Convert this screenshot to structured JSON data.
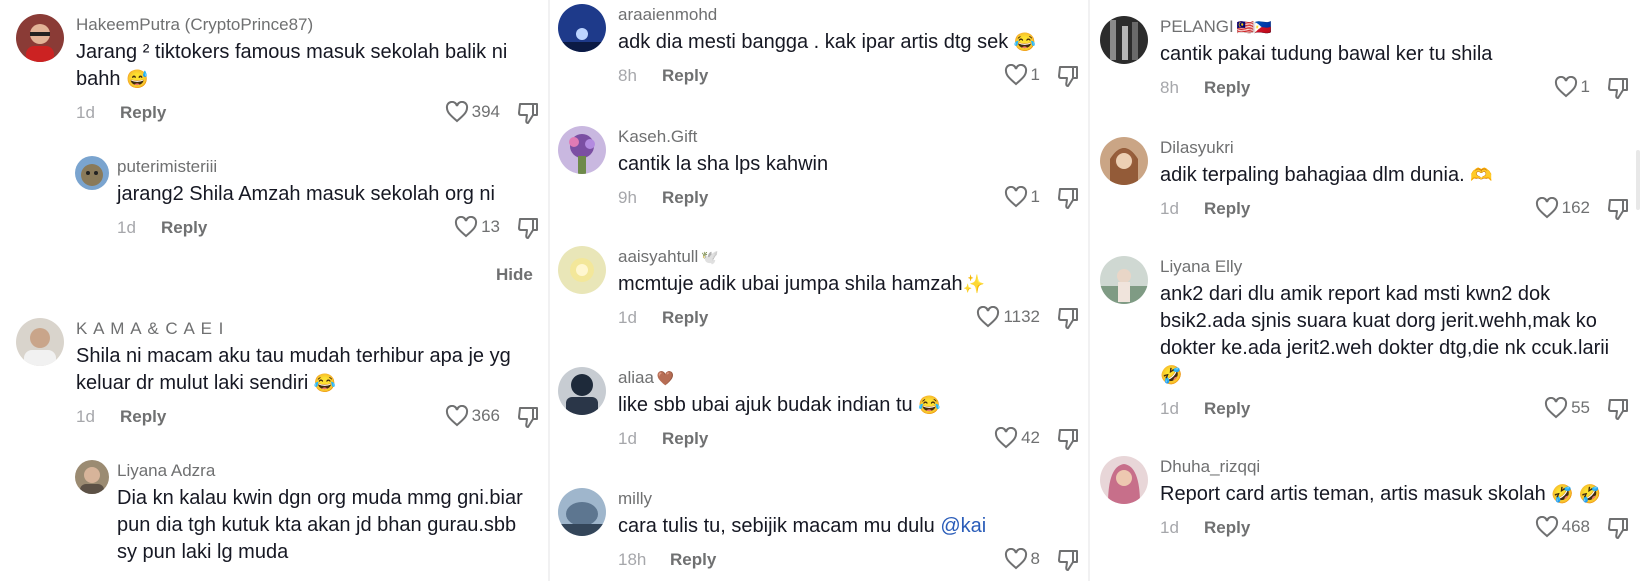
{
  "columns": [
    {
      "comments": [
        {
          "user": "HakeemPutra (CryptoPrince87)",
          "text": "Jarang ² tiktokers famous masuk sekolah balik ni bahh",
          "emoji": "😅",
          "time": "1d",
          "reply": "Reply",
          "likes": "394"
        },
        {
          "user": "puterimisteriii",
          "text": "jarang2 Shila Amzah masuk sekolah org ni",
          "emoji": "",
          "time": "1d",
          "reply": "Reply",
          "likes": "13"
        },
        {
          "user": "K A M A & C A E I",
          "text": "Shila ni macam aku tau mudah terhibur apa je yg keluar dr mulut laki sendiri",
          "emoji": "😂",
          "time": "1d",
          "reply": "Reply",
          "likes": "366"
        },
        {
          "user": "Liyana Adzra",
          "text": "Dia kn kalau kwin dgn org muda mmg gni.biar pun dia tgh kutuk kta akan jd bhan gurau.sbb sy pun laki lg muda",
          "emoji": "",
          "time": "",
          "reply": "",
          "likes": ""
        }
      ],
      "hide_label": "Hide"
    },
    {
      "comments": [
        {
          "user": "araaienmohd",
          "text": "adk dia mesti bangga . kak ipar artis dtg sek",
          "emoji": "😂",
          "time": "8h",
          "reply": "Reply",
          "likes": "1"
        },
        {
          "user": "Kaseh.Gift",
          "text": "cantik la sha lps kahwin",
          "emoji": "",
          "time": "9h",
          "reply": "Reply",
          "likes": "1"
        },
        {
          "user": "aaisyahtull",
          "user_emoji": "🕊️",
          "text": "mcmtuje adik ubai jumpa shila hamzah",
          "emoji": "✨",
          "time": "1d",
          "reply": "Reply",
          "likes": "1132"
        },
        {
          "user": "aliaa",
          "user_emoji": "🤎",
          "text": "like sbb ubai ajuk budak indian tu",
          "emoji": "😂",
          "time": "1d",
          "reply": "Reply",
          "likes": "42"
        },
        {
          "user": "milly",
          "text": "cara tulis tu, sebijik macam mu dulu",
          "mention": "@kai",
          "emoji": "",
          "time": "18h",
          "reply": "Reply",
          "likes": "8"
        }
      ]
    },
    {
      "comments": [
        {
          "user": "PELANGI",
          "user_emoji": "🇲🇾🇵🇭",
          "text": "cantik pakai tudung bawal ker tu shila",
          "emoji": "",
          "time": "8h",
          "reply": "Reply",
          "likes": "1"
        },
        {
          "user": "Dilasyukri",
          "text": "adik terpaling bahagiaa dlm dunia.",
          "emoji": "🫶",
          "time": "1d",
          "reply": "Reply",
          "likes": "162"
        },
        {
          "user": "Liyana Elly",
          "text": "ank2 dari dlu amik report kad msti kwn2 dok bsik2.ada sjnis suara kuat dorg jerit.wehh,mak ko dokter ke.ada jerit2.weh dokter dtg,die nk ccuk.larii",
          "emoji": "🤣",
          "time": "1d",
          "reply": "Reply",
          "likes": "55"
        },
        {
          "user": "Dhuha_rizqqi",
          "text": "Report card artis teman, artis masuk skolah",
          "emoji": "🤣 🤣",
          "time": "1d",
          "reply": "Reply",
          "likes": "468"
        }
      ]
    }
  ],
  "colors": {
    "username": "#6f7071",
    "text": "#161823",
    "meta": "#a6a7ab",
    "mention": "#2b5db9"
  },
  "icons": {
    "like": "heart-outline-icon",
    "dislike": "thumbs-down-icon"
  }
}
